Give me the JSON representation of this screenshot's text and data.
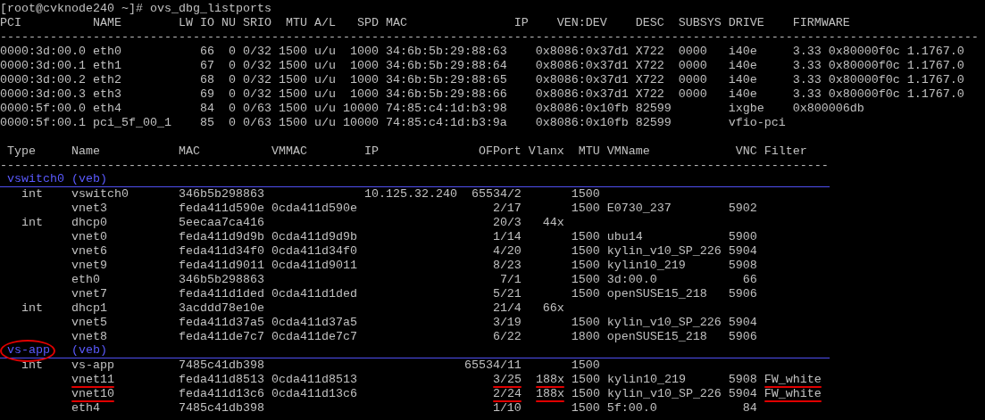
{
  "terminal": {
    "lines": [
      {
        "kind": "text",
        "segments": [
          {
            "text": "[root@cvknode240 ~]# ovs_dbg_listports"
          }
        ]
      },
      {
        "kind": "text",
        "segments": [
          {
            "text": "PCI          NAME        LW IO NU SRIO  MTU A/L   SPD MAC               IP    VEN:DEV    DESC  SUBSYS DRIVE    FIRMWARE"
          }
        ]
      },
      {
        "kind": "text",
        "segments": [
          {
            "text": "-----------------------------------------------------------------------------------------------------------------------------------------"
          }
        ]
      },
      {
        "kind": "text",
        "segments": [
          {
            "text": "0000:3d:00.0 eth0           66  0 0/32 1500 u/u  1000 34:6b:5b:29:88:63    0x8086:0x37d1 X722  0000   i40e     3.33 0x80000f0c 1.1767.0"
          }
        ]
      },
      {
        "kind": "text",
        "segments": [
          {
            "text": "0000:3d:00.1 eth1           67  0 0/32 1500 u/u  1000 34:6b:5b:29:88:64    0x8086:0x37d1 X722  0000   i40e     3.33 0x80000f0c 1.1767.0"
          }
        ]
      },
      {
        "kind": "text",
        "segments": [
          {
            "text": "0000:3d:00.2 eth2           68  0 0/32 1500 u/u  1000 34:6b:5b:29:88:65    0x8086:0x37d1 X722  0000   i40e     3.33 0x80000f0c 1.1767.0"
          }
        ]
      },
      {
        "kind": "text",
        "segments": [
          {
            "text": "0000:3d:00.3 eth3           69  0 0/32 1500 u/u  1000 34:6b:5b:29:88:66    0x8086:0x37d1 X722  0000   i40e     3.33 0x80000f0c 1.1767.0"
          }
        ]
      },
      {
        "kind": "text",
        "segments": [
          {
            "text": "0000:5f:00.0 eth4           84  0 0/63 1500 u/u 10000 74:85:c4:1d:b3:98    0x8086:0x10fb 82599        ixgbe    0x800006db"
          }
        ]
      },
      {
        "kind": "text",
        "segments": [
          {
            "text": "0000:5f:00.1 pci_5f_00_1    85  0 0/63 1500 u/u 10000 74:85:c4:1d:b3:9a    0x8086:0x10fb 82599        vfio-pci"
          }
        ]
      },
      {
        "kind": "blank"
      },
      {
        "kind": "text",
        "segments": [
          {
            "text": " Type     Name           MAC          VMMAC        IP              OFPort Vlanx  MTU VMName            VNC Filter"
          }
        ]
      },
      {
        "kind": "text",
        "segments": [
          {
            "text": "--------------------------------------------------------------------------------------------------------------------"
          }
        ]
      },
      {
        "kind": "bridge",
        "segments": [
          {
            "text": " vswitch0 (veb)"
          }
        ]
      },
      {
        "kind": "text",
        "segments": [
          {
            "text": "   int    vswitch0       346b5b298863              10.125.32.240  65534/2       1500"
          }
        ]
      },
      {
        "kind": "text",
        "segments": [
          {
            "text": "          vnet3          feda411d590e 0cda411d590e                   2/17       1500 E0730_237        5902"
          }
        ]
      },
      {
        "kind": "text",
        "segments": [
          {
            "text": "   int    dhcp0          5eecaa7ca416                                20/3   44x"
          }
        ]
      },
      {
        "kind": "text",
        "segments": [
          {
            "text": "          vnet0          feda411d9d9b 0cda411d9d9b                   1/14       1500 ubu14            5900"
          }
        ]
      },
      {
        "kind": "text",
        "segments": [
          {
            "text": "          vnet6          feda411d34f0 0cda411d34f0                   4/20       1500 kylin_v10_SP_226 5904"
          }
        ]
      },
      {
        "kind": "text",
        "segments": [
          {
            "text": "          vnet9          feda411d9011 0cda411d9011                   8/23       1500 kylin10_219      5908"
          }
        ]
      },
      {
        "kind": "text",
        "segments": [
          {
            "text": "          eth0           346b5b298863                                 7/1       1500 3d:00.0            66"
          }
        ]
      },
      {
        "kind": "text",
        "segments": [
          {
            "text": "          vnet7          feda411d1ded 0cda411d1ded                   5/21       1500 openSUSE15_218   5906"
          }
        ]
      },
      {
        "kind": "text",
        "segments": [
          {
            "text": "   int    dhcp1          3acddd78e10e                                21/4   66x"
          }
        ]
      },
      {
        "kind": "text",
        "segments": [
          {
            "text": "          vnet5          feda411d37a5 0cda411d37a5                   3/19       1500 kylin_v10_SP_226 5904"
          }
        ]
      },
      {
        "kind": "text",
        "segments": [
          {
            "text": "          vnet8          feda411de7c7 0cda411de7c7                   6/22       1800 openSUSE15_218   5906"
          }
        ]
      },
      {
        "kind": "bridge",
        "segments": [
          {
            "text": " vs-app",
            "kind": "circled"
          },
          {
            "text": "   (veb)",
            "kind": "plain"
          }
        ]
      },
      {
        "kind": "text",
        "segments": [
          {
            "text": "   int    vs-app         7485c41db398                            65534/11       1500"
          }
        ]
      },
      {
        "kind": "text",
        "segments": [
          {
            "text": "          vnet11",
            "kind": "underlined"
          },
          {
            "text": "         feda411d8513 0cda411d8513",
            "kind": "plain"
          },
          {
            "text": "                   3/25",
            "kind": "underlined"
          },
          {
            "text": "  188x",
            "kind": "underlined"
          },
          {
            "text": " 1500 kylin10_219      5908",
            "kind": "plain"
          },
          {
            "text": " FW_white",
            "kind": "underlined"
          }
        ]
      },
      {
        "kind": "text",
        "segments": [
          {
            "text": "          vnet10",
            "kind": "underlined"
          },
          {
            "text": "         feda411d13c6 0cda411d13c6",
            "kind": "plain"
          },
          {
            "text": "                   2/24",
            "kind": "underlined"
          },
          {
            "text": "  188x",
            "kind": "underlined"
          },
          {
            "text": " 1500 kylin_v10_SP_226 5904",
            "kind": "plain"
          },
          {
            "text": " FW_white",
            "kind": "underlined"
          }
        ]
      },
      {
        "kind": "text",
        "segments": [
          {
            "text": "          eth4           7485c41db398                                1/10       1500 5f:00.0            84"
          }
        ]
      }
    ]
  }
}
